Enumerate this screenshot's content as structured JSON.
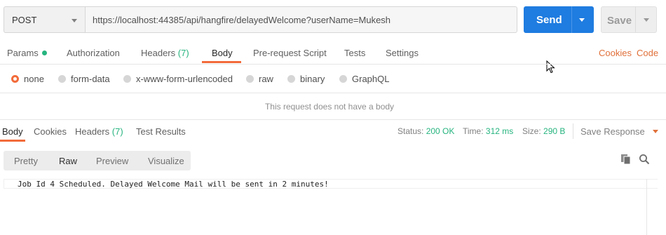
{
  "request": {
    "method": "POST",
    "url": "https://localhost:44385/api/hangfire/delayedWelcome?userName=Mukesh",
    "send_label": "Send",
    "save_label": "Save"
  },
  "request_tabs": [
    {
      "label": "Params",
      "active": false
    },
    {
      "label": "Authorization",
      "active": false
    },
    {
      "label": "Headers",
      "count": "(7)",
      "active": false
    },
    {
      "label": "Body",
      "active": true
    },
    {
      "label": "Pre-request Script",
      "active": false
    },
    {
      "label": "Tests",
      "active": false
    },
    {
      "label": "Settings",
      "active": false
    }
  ],
  "links": {
    "cookies": "Cookies",
    "code": "Code"
  },
  "body_types": [
    {
      "label": "none",
      "selected": true
    },
    {
      "label": "form-data",
      "selected": false
    },
    {
      "label": "x-www-form-urlencoded",
      "selected": false
    },
    {
      "label": "raw",
      "selected": false
    },
    {
      "label": "binary",
      "selected": false
    },
    {
      "label": "GraphQL",
      "selected": false
    }
  ],
  "no_body_message": "This request does not have a body",
  "response": {
    "tabs": [
      {
        "label": "Body",
        "active": true
      },
      {
        "label": "Cookies",
        "active": false
      },
      {
        "label": "Headers",
        "count": "(7)",
        "active": false
      },
      {
        "label": "Test Results",
        "active": false
      }
    ],
    "status_label": "Status:",
    "status_value": "200 OK",
    "time_label": "Time:",
    "time_value": "312 ms",
    "size_label": "Size:",
    "size_value": "290 B",
    "save_response": "Save Response",
    "formats": [
      "Pretty",
      "Raw",
      "Preview",
      "Visualize"
    ],
    "active_format": "Raw",
    "body_text": "Job Id 4 Scheduled. Delayed Welcome Mail will be sent in 2 minutes!"
  },
  "colors": {
    "accent": "#f26b3a",
    "primary": "#1f7ce0",
    "success": "#26b47f"
  },
  "icons": {
    "copy": "copy-icon",
    "search": "search-icon",
    "cursor": "mouse-cursor-icon"
  }
}
